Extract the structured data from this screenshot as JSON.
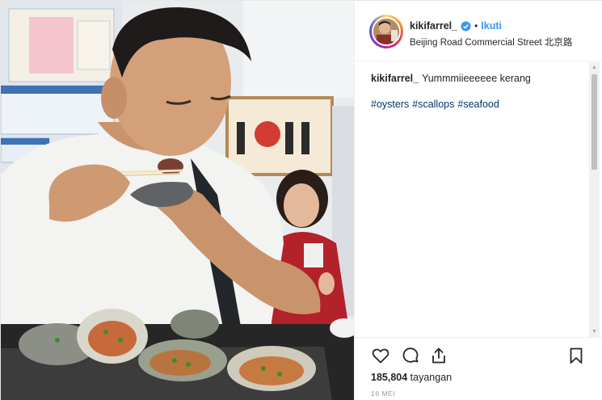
{
  "post": {
    "author": {
      "username": "kikifarrel_",
      "verified": true,
      "follow_label": "Ikuti",
      "separator": "•"
    },
    "location": "Beijing Road Commercial Street 北京路",
    "caption": {
      "username": "kikifarrel_",
      "text": "Yummmiieeeeee kerang"
    },
    "hashtags": [
      "#oysters",
      "#scallops",
      "#seafood"
    ],
    "stats": {
      "views": "185,804",
      "views_label": "tayangan"
    },
    "date": "16 MEI"
  },
  "icons": {
    "like": "heart-icon",
    "comment": "comment-icon",
    "share": "share-icon",
    "save": "bookmark-icon",
    "verified": "verified-badge-icon"
  },
  "colors": {
    "link_blue": "#3897f0",
    "hashtag": "#003569",
    "border": "#efefef",
    "verified_blue": "#3897f0"
  }
}
